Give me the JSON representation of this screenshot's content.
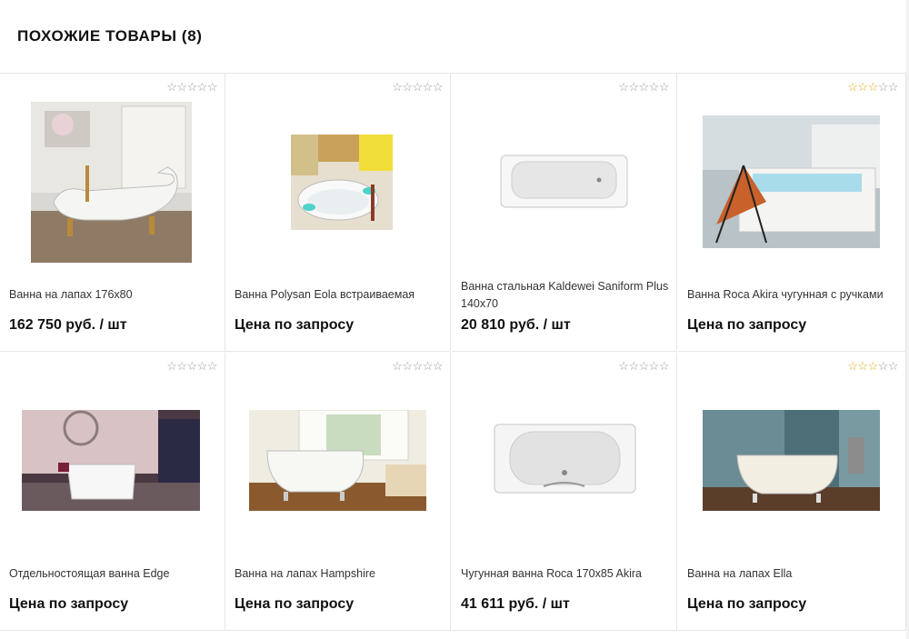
{
  "section": {
    "title": "ПОХОЖИЕ ТОВАРЫ (8)"
  },
  "colors": {
    "star_active": "#e3a812",
    "star_inactive": "#9a9a9a",
    "border": "#e6e6e6"
  },
  "products": [
    {
      "name": "Ванна на лапах 176x80",
      "price": "162 750 руб. / шт",
      "rating": 0,
      "icon": "clawfoot-bath-image"
    },
    {
      "name": "Ванна Polysan Eola встраиваемая",
      "price": "Цена по запросу",
      "rating": 0,
      "icon": "oval-bath-image"
    },
    {
      "name": "Ванна стальная Kaldewei Saniform Plus 140x70",
      "price": "20 810 руб. / шт",
      "rating": 0,
      "icon": "steel-bath-image"
    },
    {
      "name": "Ванна Roca Akira чугунная с ручками",
      "price": "Цена по запросу",
      "rating": 3,
      "icon": "built-in-bath-image"
    },
    {
      "name": "Отдельностоящая ванна Edge",
      "price": "Цена по запросу",
      "rating": 0,
      "icon": "freestanding-bath-image"
    },
    {
      "name": "Ванна на лапах Hampshire",
      "price": "Цена по запросу",
      "rating": 0,
      "icon": "clawfoot-bath-image"
    },
    {
      "name": "Чугунная ванна Roca 170x85 Akira",
      "price": "41 611 руб. / шт",
      "rating": 0,
      "icon": "cast-iron-bath-image"
    },
    {
      "name": "Ванна на лапах Ella",
      "price": "Цена по запросу",
      "rating": 3,
      "icon": "clawfoot-bath-image"
    }
  ]
}
